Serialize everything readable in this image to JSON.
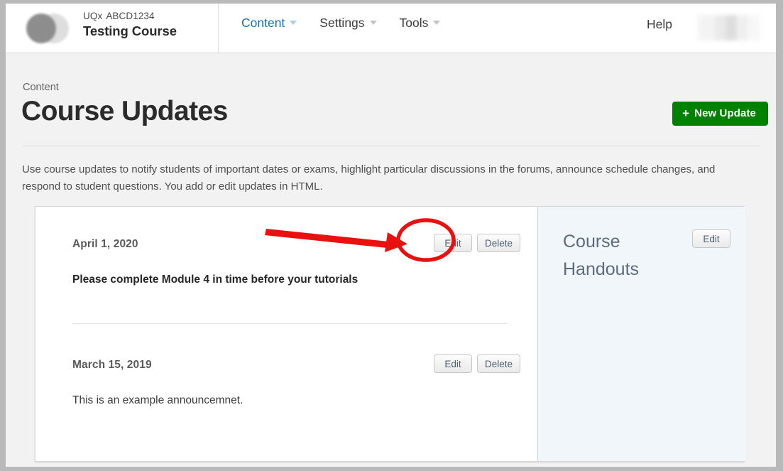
{
  "header": {
    "logo_icon": "overlapping-circles-logo",
    "course_org": "UQx",
    "course_code": "ABCD1234",
    "course_name": "Testing Course",
    "nav": [
      {
        "label": "Content",
        "active": true,
        "caret": "chevron-down-icon"
      },
      {
        "label": "Settings",
        "active": false,
        "caret": "chevron-down-icon"
      },
      {
        "label": "Tools",
        "active": false,
        "caret": "chevron-down-icon"
      }
    ],
    "help_label": "Help",
    "user_menu": "redacted-user-name"
  },
  "page": {
    "breadcrumb": "Content",
    "title": "Course Updates",
    "new_update_label": "New Update",
    "new_update_icon": "plus-icon",
    "new_update_color": "#008100",
    "description": "Use course updates to notify students of important dates or exams, highlight particular discussions in the forums, announce schedule changes, and respond to student questions. You add or edit updates in HTML."
  },
  "updates": [
    {
      "date": "April 1, 2020",
      "body": "Please complete Module 4 in time before your tutorials",
      "edit_label": "Edit",
      "delete_label": "Delete"
    },
    {
      "date": "March 15, 2019",
      "body": "This is an example announcemnet.",
      "edit_label": "Edit",
      "delete_label": "Delete"
    }
  ],
  "handouts": {
    "title": "Course Handouts",
    "edit_label": "Edit",
    "background_color": "#f1f6fb"
  },
  "annotation": {
    "color": "#e8110f",
    "arrow": "red-arrow-pointing-to-edit-button",
    "highlight": "red-ellipse-around-edit-button"
  }
}
